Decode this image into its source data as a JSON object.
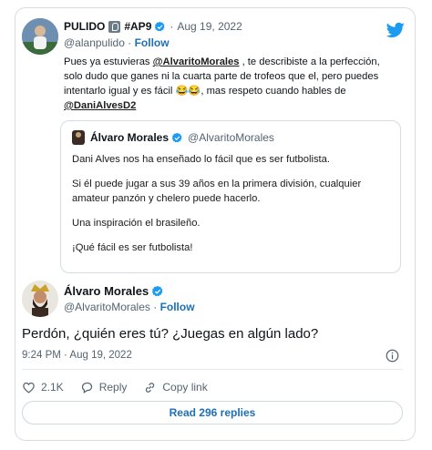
{
  "colors": {
    "link": "#1d6fb8",
    "verified": "#1d9bf0",
    "muted": "#536471",
    "border": "#d6dde2"
  },
  "parent_tweet": {
    "display_name": "PULIDO",
    "badge_icon": "broadcast-badge-icon",
    "tag": "#AP9",
    "separator": "·",
    "date": "Aug 19, 2022",
    "handle": "@alanpulido",
    "dot": "·",
    "follow_label": "Follow",
    "text_before": "Pues ya estuvieras ",
    "mention1": "@AlvaritoMorales",
    "text_middle": " , te describiste a la perfección, solo dudo que ganes ni la cuarta parte de trofeos que el, pero puedes intentarlo igual y es fácil 😂😂, mas respeto cuando hables de ",
    "mention2": "@DaniAlvesD2"
  },
  "quoted_tweet": {
    "display_name": "Álvaro Morales",
    "handle": "@AlvaritoMorales",
    "paragraphs": [
      "Dani Alves nos ha enseñado lo fácil que es ser futbolista.",
      "Si él puede jugar a sus 39 años en la primera división, cualquier amateur panzón y chelero puede hacerlo.",
      "Una inspiración el brasileño.",
      "¡Qué fácil es ser futbolista!"
    ]
  },
  "main_tweet": {
    "display_name": "Álvaro Morales",
    "handle": "@AlvaritoMorales",
    "dot": "·",
    "follow_label": "Follow",
    "text": "Perdón, ¿quién eres tú? ¿Juegas en algún lado?",
    "timestamp": "9:24 PM · Aug 19, 2022",
    "likes": "2.1K",
    "reply_label": "Reply",
    "copy_link_label": "Copy link",
    "read_replies_label": "Read 296 replies"
  }
}
